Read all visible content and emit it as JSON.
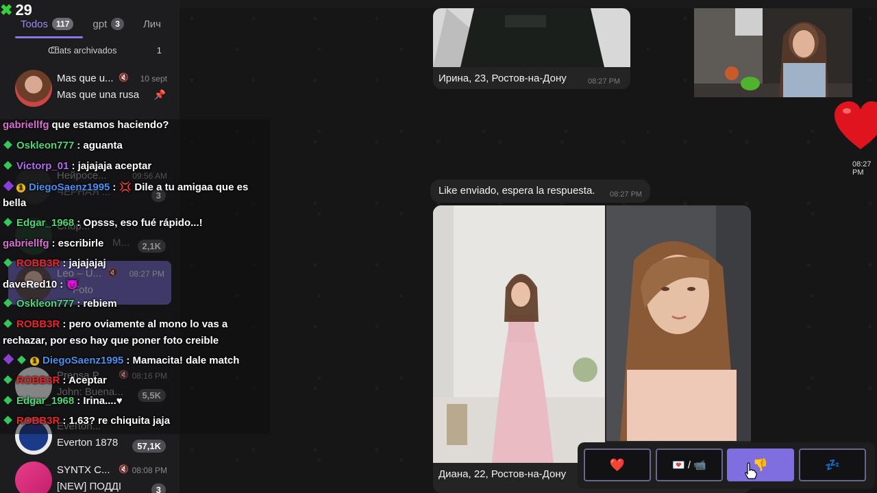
{
  "streak": {
    "count": "29",
    "icon": "x-logo-icon",
    "color": "#35d13a"
  },
  "tabs": [
    {
      "label": "Todos",
      "count": "117"
    },
    {
      "label": "gpt",
      "count": "3"
    },
    {
      "label": "Лич"
    }
  ],
  "archived": {
    "label": "Chats archivados",
    "count": "1"
  },
  "chats": [
    {
      "title": "Mas que u...",
      "time": "10 sept",
      "preview": "Mas que una rusa"
    },
    {
      "title": "Нейросе...",
      "time": "09:56 AM",
      "preview": "ЧЕРНАЯ ...",
      "count": "3"
    },
    {
      "title": "Chop...",
      "preview": "M...",
      "count": "2,1K"
    },
    {
      "title": "Leo – U...",
      "time": "08:27 PM",
      "preview": "Foto"
    },
    {
      "title": "Prensa P...",
      "time": "08:16 PM",
      "preview": "John: Buena...",
      "count": "5,5K"
    },
    {
      "title": "Everton...",
      "preview": "Everton 1878",
      "count": "57,1K"
    },
    {
      "title": "SYNTX C...",
      "time": "08:08 PM",
      "preview": "[NEW] ПОДДІ",
      "count": "3"
    }
  ],
  "messages": {
    "caption1": "Ирина, 23, Ростов-на-Дону",
    "time1": "08:27 PM",
    "time_heart": "08:27 PM",
    "like_text": "Like enviado, espera la respuesta.",
    "time2": "08:27 PM",
    "caption2": "Диана, 22, Ростов-на-Дону"
  },
  "reaction_buttons": [
    {
      "label": "❤️",
      "icon": "heart-icon"
    },
    {
      "label": "💌 / 📹",
      "icon": "letter-video-icon"
    },
    {
      "label": "👎",
      "icon": "thumbs-down-icon"
    },
    {
      "label": "💤",
      "icon": "sleep-icon"
    }
  ],
  "stream_chat": [
    {
      "user": "gabriellfg",
      "color": "#d96fd0",
      "text": "que estamos haciendo?",
      "badges": []
    },
    {
      "user": "Oskleon777",
      "color": "#54d676",
      "text": ": aguanta",
      "badges": [
        "diamond"
      ]
    },
    {
      "user": "Victorp_01",
      "color": "#b06cf0",
      "text": ": jajajaja aceptar",
      "badges": [
        "diamond"
      ]
    },
    {
      "user": "DiegoSaenz1995",
      "color": "#4a8ff0",
      "text": ": 💢 Dile a tu amigaa que es",
      "text2": "bella",
      "badges": [
        "gem",
        "coin"
      ]
    },
    {
      "user": "Edgar_1968",
      "color": "#54d676",
      "text": ": Opsss, eso fué rápido...!",
      "badges": [
        "diamond"
      ]
    },
    {
      "user": "gabriellfg",
      "color": "#d96fd0",
      "text": ": escribirle",
      "badges": []
    },
    {
      "user": "ROBB3R",
      "color": "#e8282b",
      "text": ": jajajajaj",
      "badges": [
        "diamond"
      ]
    },
    {
      "user": "daveRed10",
      "color": "#ffffff",
      "text": ": 😈",
      "badges": []
    },
    {
      "user": "Oskleon777",
      "color": "#54d676",
      "text": ": rebiem",
      "badges": [
        "diamond"
      ]
    },
    {
      "user": "ROBB3R",
      "color": "#e8282b",
      "text": ": pero oviamente al mono lo vas a",
      "text2": "rechazar, por eso hay que poner foto creible",
      "badges": [
        "diamond"
      ]
    },
    {
      "user": "DiegoSaenz1995",
      "color": "#4a8ff0",
      "text": ": Mamacita! dale match",
      "badges": [
        "gem",
        "diamond",
        "coin"
      ]
    },
    {
      "user": "ROBB3R",
      "color": "#e8282b",
      "text": ": Aceptar",
      "badges": [
        "diamond"
      ]
    },
    {
      "user": "Edgar_1968",
      "color": "#54d676",
      "text": ": Irina....♥",
      "badges": [
        "diamond"
      ]
    },
    {
      "user": "ROBB3R",
      "color": "#e8282b",
      "text": ": 1.63? re chiquita jaja",
      "badges": [
        "diamond"
      ]
    }
  ]
}
